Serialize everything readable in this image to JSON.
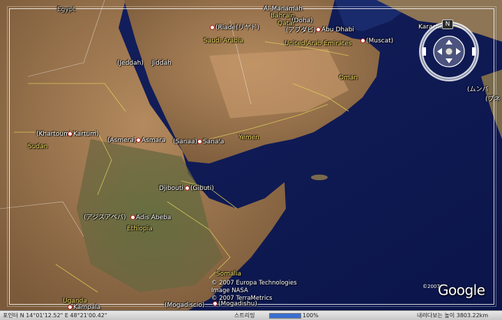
{
  "places": [
    {
      "id": "egypt",
      "text": "Egypt",
      "kind": "faded",
      "star": false
    },
    {
      "id": "al-manamah",
      "text": "Al Manamah",
      "kind": "city",
      "star": false
    },
    {
      "id": "bahrain",
      "text": "Bahrain",
      "kind": "country",
      "star": false
    },
    {
      "id": "doha",
      "text": "(Doha)",
      "kind": "city",
      "star": false
    },
    {
      "id": "qatar",
      "text": "Qatar",
      "kind": "country",
      "star": false
    },
    {
      "id": "abu-dhabi-ja",
      "text": "(アブダビ)",
      "kind": "city",
      "star": false
    },
    {
      "id": "abu-dhabi",
      "text": "Abu Dhabi",
      "kind": "city",
      "star": true
    },
    {
      "id": "uae",
      "text": "United Arab Emirates",
      "kind": "country",
      "star": false
    },
    {
      "id": "karachi",
      "text": "Karachi",
      "kind": "city",
      "star": false
    },
    {
      "id": "riade",
      "text": "(Riade)",
      "kind": "city",
      "star": true
    },
    {
      "id": "riyadh-ja",
      "text": "(リヤド)",
      "kind": "city",
      "star": false
    },
    {
      "id": "saudi-arabia",
      "text": "Saudi Arabia",
      "kind": "country",
      "star": false
    },
    {
      "id": "muscat",
      "text": "(Muscat)",
      "kind": "city",
      "star": true
    },
    {
      "id": "jeddah-paren",
      "text": "(Jeddah)",
      "kind": "city",
      "star": false
    },
    {
      "id": "jiddah",
      "text": "Jiddah",
      "kind": "city",
      "star": false
    },
    {
      "id": "oman",
      "text": "Oman",
      "kind": "country",
      "star": false
    },
    {
      "id": "mumbai-ja",
      "text": "(ムンバ",
      "kind": "city",
      "star": false
    },
    {
      "id": "pune-ja",
      "text": "(プネ",
      "kind": "city",
      "star": false
    },
    {
      "id": "khartoum",
      "text": "(Khartoum)",
      "kind": "city",
      "star": false
    },
    {
      "id": "kartum",
      "text": "Kartum)",
      "kind": "city",
      "star": true
    },
    {
      "id": "asmera",
      "text": "(Asmera)",
      "kind": "city",
      "star": false
    },
    {
      "id": "asmara",
      "text": "Asmara",
      "kind": "city",
      "star": true
    },
    {
      "id": "sanaa",
      "text": "(Sanaa)",
      "kind": "city",
      "star": false
    },
    {
      "id": "sanaa2",
      "text": "Sana'a",
      "kind": "city",
      "star": true
    },
    {
      "id": "yemen",
      "text": "Yemen",
      "kind": "country",
      "star": false
    },
    {
      "id": "sudan",
      "text": "Sudan",
      "kind": "country",
      "star": false
    },
    {
      "id": "djibouti",
      "text": "Djibouti",
      "kind": "city",
      "star": false
    },
    {
      "id": "gibuti",
      "text": "(Gibuti)",
      "kind": "city",
      "star": true
    },
    {
      "id": "addis-ja",
      "text": "(アジスアベバ)",
      "kind": "city",
      "star": false
    },
    {
      "id": "adis-abeba",
      "text": "Adis Abeba",
      "kind": "city",
      "star": true
    },
    {
      "id": "ethiopia",
      "text": "Ethiopia",
      "kind": "country",
      "star": false
    },
    {
      "id": "somalia",
      "text": "Somalia",
      "kind": "country",
      "star": false
    },
    {
      "id": "uganda",
      "text": "Uganda",
      "kind": "country",
      "star": false
    },
    {
      "id": "kampala",
      "text": "Kampala",
      "kind": "city",
      "star": true
    },
    {
      "id": "mogadiscio",
      "text": "(Mogadiscio)",
      "kind": "city",
      "star": false
    },
    {
      "id": "mogadishu",
      "text": "(Mogadishu)",
      "kind": "city",
      "star": true
    }
  ],
  "credits": {
    "line1": "© 2007 Europa Technologies",
    "line2": "Image NASA",
    "line3": "© 2007 TerraMetrics"
  },
  "logo": {
    "text": "Google",
    "year": "©2007"
  },
  "nav": {
    "north_label": "N"
  },
  "status": {
    "coords": "포인터 N 14°01'12.52\"  E 48°21'00.42\"",
    "streaming_label": "스트리밍",
    "streaming_percent": "100%",
    "eye_alt": "내려다보는 높이   3803.22km",
    "streaming_fraction": 1.0
  }
}
